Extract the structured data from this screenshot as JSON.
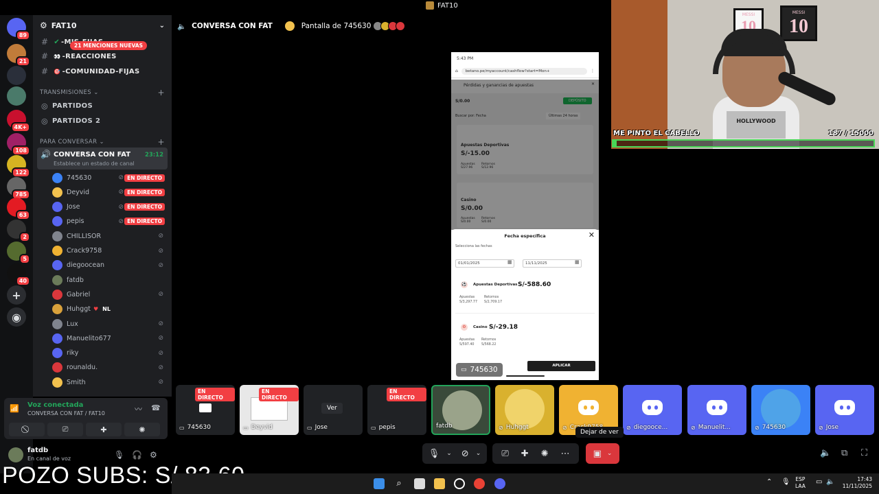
{
  "window": {
    "title": "FAT10"
  },
  "servers": [
    {
      "name": "inbox",
      "badge": "89",
      "color": "#5865f2"
    },
    {
      "name": "server-1",
      "badge": "21",
      "color": "#c17c3a"
    },
    {
      "name": "server-2",
      "badge": "",
      "color": "#2a2f3a"
    },
    {
      "name": "server-3",
      "badge": "",
      "color": "#4a7a6a"
    },
    {
      "name": "server-4",
      "badge": "4K+",
      "color": "#c8102e"
    },
    {
      "name": "server-5",
      "badge": "108",
      "color": "#a02066"
    },
    {
      "name": "server-6",
      "badge": "122",
      "color": "#d6b422"
    },
    {
      "name": "server-7",
      "badge": "785",
      "color": "#666"
    },
    {
      "name": "server-8",
      "badge": "63",
      "color": "#e31b23"
    },
    {
      "name": "server-9",
      "badge": "2",
      "color": "#333"
    },
    {
      "name": "server-10",
      "badge": "5",
      "color": "#556b2f"
    },
    {
      "name": "server-11",
      "badge": "40",
      "color": "#111"
    }
  ],
  "sidebar": {
    "server_name": "FAT10",
    "mentions": "21 MENCIONES NUEVAS",
    "channels": [
      {
        "label": "-MIS-FIJAS",
        "emoji": "✔"
      },
      {
        "label": "-REACCIONES",
        "emoji": "👀"
      },
      {
        "label": "-COMUNIDAD-FIJAS",
        "emoji": "🎯"
      }
    ],
    "category_streams": "TRANSMISIONES",
    "stream_channels": [
      "PARTIDOS",
      "PARTIDOS 2"
    ],
    "category_talk": "PARA CONVERSAR",
    "active_channel": {
      "name": "CONVERSA CON FAT",
      "time": "23:12",
      "status": "Establece un estado de canal"
    },
    "live_label": "EN DIRECTO",
    "members": [
      {
        "name": "745630",
        "live": true,
        "color": "#3b82f6"
      },
      {
        "name": "Deyvid",
        "live": true,
        "color": "#f2c14e"
      },
      {
        "name": "Jose",
        "live": true,
        "color": "#5865f2"
      },
      {
        "name": "pepis",
        "live": true,
        "color": "#5865f2"
      },
      {
        "name": "CHILLISOR",
        "live": false,
        "color": "#80848e"
      },
      {
        "name": "Crack9758",
        "live": false,
        "color": "#f0b232"
      },
      {
        "name": "diegoocean",
        "live": false,
        "color": "#5865f2"
      },
      {
        "name": "fatdb",
        "live": false,
        "color": "#6b7b5a"
      },
      {
        "name": "Gabriel",
        "live": false,
        "color": "#da373c"
      },
      {
        "name": "Huhggt",
        "live": false,
        "color": "#d9a13b",
        "tag": "NL"
      },
      {
        "name": "Lux",
        "live": false,
        "color": "#80848e"
      },
      {
        "name": "Manuelito677",
        "live": false,
        "color": "#5865f2"
      },
      {
        "name": "riky",
        "live": false,
        "color": "#5865f2"
      },
      {
        "name": "rounaldu.",
        "live": false,
        "color": "#da373c"
      },
      {
        "name": "Smith",
        "live": false,
        "color": "#f2c14e"
      }
    ]
  },
  "voice_panel": {
    "title": "Voz conectada",
    "subtitle": "CONVERSA CON FAT / FAT10"
  },
  "user_panel": {
    "name": "fatdb",
    "status": "En canal de voz"
  },
  "overlay": {
    "pozo": "POZO SUBS: S/ 83.60"
  },
  "call_header": {
    "channel": "CONVERSA CON FAT",
    "screen": "Pantalla de 745630"
  },
  "phone": {
    "time": "5:43 PM",
    "url": "betano.pe/myaccount/cashflow?start=Mon+",
    "page_title": "Pérdidas y ganancias de apuestas",
    "balance": "S/0.00",
    "deposit": "DEPÓSITO",
    "filter_label": "Buscar por: Fecha",
    "filter_value": "Últimas 24 horas",
    "bg_sports_title": "Apuestas Deportivas",
    "bg_sports_value": "S/-15.00",
    "bg_sports_bets": "Apuestas\nS/27.96",
    "bg_sports_returns": "Retornos\nS/12.96",
    "bg_casino_title": "Casino",
    "bg_casino_value": "S/0.00",
    "bg_casino_bets": "Apuestas\nS/0.00",
    "bg_casino_returns": "Retornos\nS/0.00",
    "modal_title": "Fecha específica",
    "modal_subtitle": "Selecciona las fechas",
    "date_from": "01/01/2025",
    "date_to": "11/11/2025",
    "sports_title": "Apuestas Deportivas",
    "sports_value": "S/-588.60",
    "sports_bets": "Apuestas\nS/3,297.77",
    "sports_returns": "Retornos\nS/2,709.17",
    "casino_title": "Casino",
    "casino_value": "S/-29.18",
    "casino_bets": "Apuestas\nS/597.40",
    "casino_returns": "Retornos\nS/568.22",
    "apply": "APLICAR"
  },
  "share_tag": "745630",
  "webcam": {
    "jersey_left": "10",
    "jersey_right": "10",
    "jersey_name": "MESSI",
    "shirt_text": "HOLLYWOOD",
    "goal_label": "ME PINTO EL CABELLO",
    "goal_count": "187  / 15000",
    "goal_progress": 0.0125
  },
  "tiles": [
    {
      "label": "745630",
      "live": true,
      "kind": "screen",
      "color": "#202225"
    },
    {
      "label": "Deyvid",
      "live": true,
      "kind": "preview",
      "color": "#e8e8e8"
    },
    {
      "label": "Jose",
      "live": false,
      "kind": "ver",
      "color": "#202225",
      "action": "Ver"
    },
    {
      "label": "pepis",
      "live": true,
      "kind": "dark",
      "color": "#202225"
    },
    {
      "label": "fatdb",
      "live": false,
      "kind": "avatar",
      "color": "#3a4a3a"
    },
    {
      "label": "Huhggt",
      "live": false,
      "kind": "avatar",
      "color": "#d9b12e"
    },
    {
      "label": "Crack9758",
      "live": false,
      "kind": "discord",
      "color": "#f0b232"
    },
    {
      "label": "diegooce...",
      "live": false,
      "kind": "discord",
      "color": "#5865f2"
    },
    {
      "label": "Manuelit...",
      "live": false,
      "kind": "discord",
      "color": "#5865f2"
    },
    {
      "label": "745630",
      "live": false,
      "kind": "avatar",
      "color": "#3b82f6"
    },
    {
      "label": "Jose",
      "live": false,
      "kind": "discord",
      "color": "#5865f2"
    }
  ],
  "controls": {
    "tooltip": "Dejar de ver"
  },
  "taskbar": {
    "lang1": "ESP",
    "lang2": "LAA",
    "time": "17:43",
    "date": "11/11/2025"
  }
}
